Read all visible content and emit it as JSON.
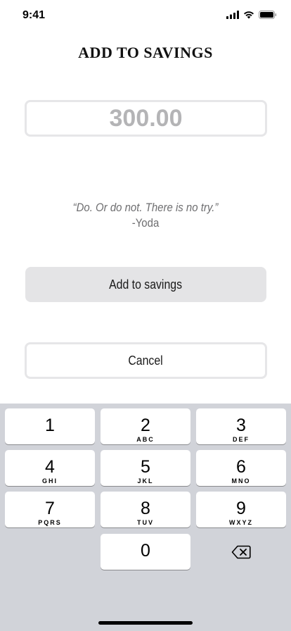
{
  "status_bar": {
    "time": "9:41"
  },
  "page": {
    "title": "ADD TO SAVINGS"
  },
  "amount": {
    "placeholder": "300.00",
    "value": ""
  },
  "quote": {
    "text": "“Do. Or do not. There is no try.”",
    "author": "-Yoda"
  },
  "buttons": {
    "add_label": "Add to savings",
    "cancel_label": "Cancel"
  },
  "keypad": {
    "keys": [
      {
        "digit": "1",
        "letters": ""
      },
      {
        "digit": "2",
        "letters": "ABC"
      },
      {
        "digit": "3",
        "letters": "DEF"
      },
      {
        "digit": "4",
        "letters": "GHI"
      },
      {
        "digit": "5",
        "letters": "JKL"
      },
      {
        "digit": "6",
        "letters": "MNO"
      },
      {
        "digit": "7",
        "letters": "PQRS"
      },
      {
        "digit": "8",
        "letters": "TUV"
      },
      {
        "digit": "9",
        "letters": "WXYZ"
      },
      {
        "digit": "0",
        "letters": ""
      }
    ],
    "delete_icon": "backspace-icon"
  },
  "colors": {
    "background": "#ffffff",
    "keyboard_background": "#d1d3d9",
    "primary_button": "#e4e4e6",
    "border": "#e6e6e8",
    "placeholder_text": "#b4b4b6",
    "quote_text": "#6e6e70"
  }
}
